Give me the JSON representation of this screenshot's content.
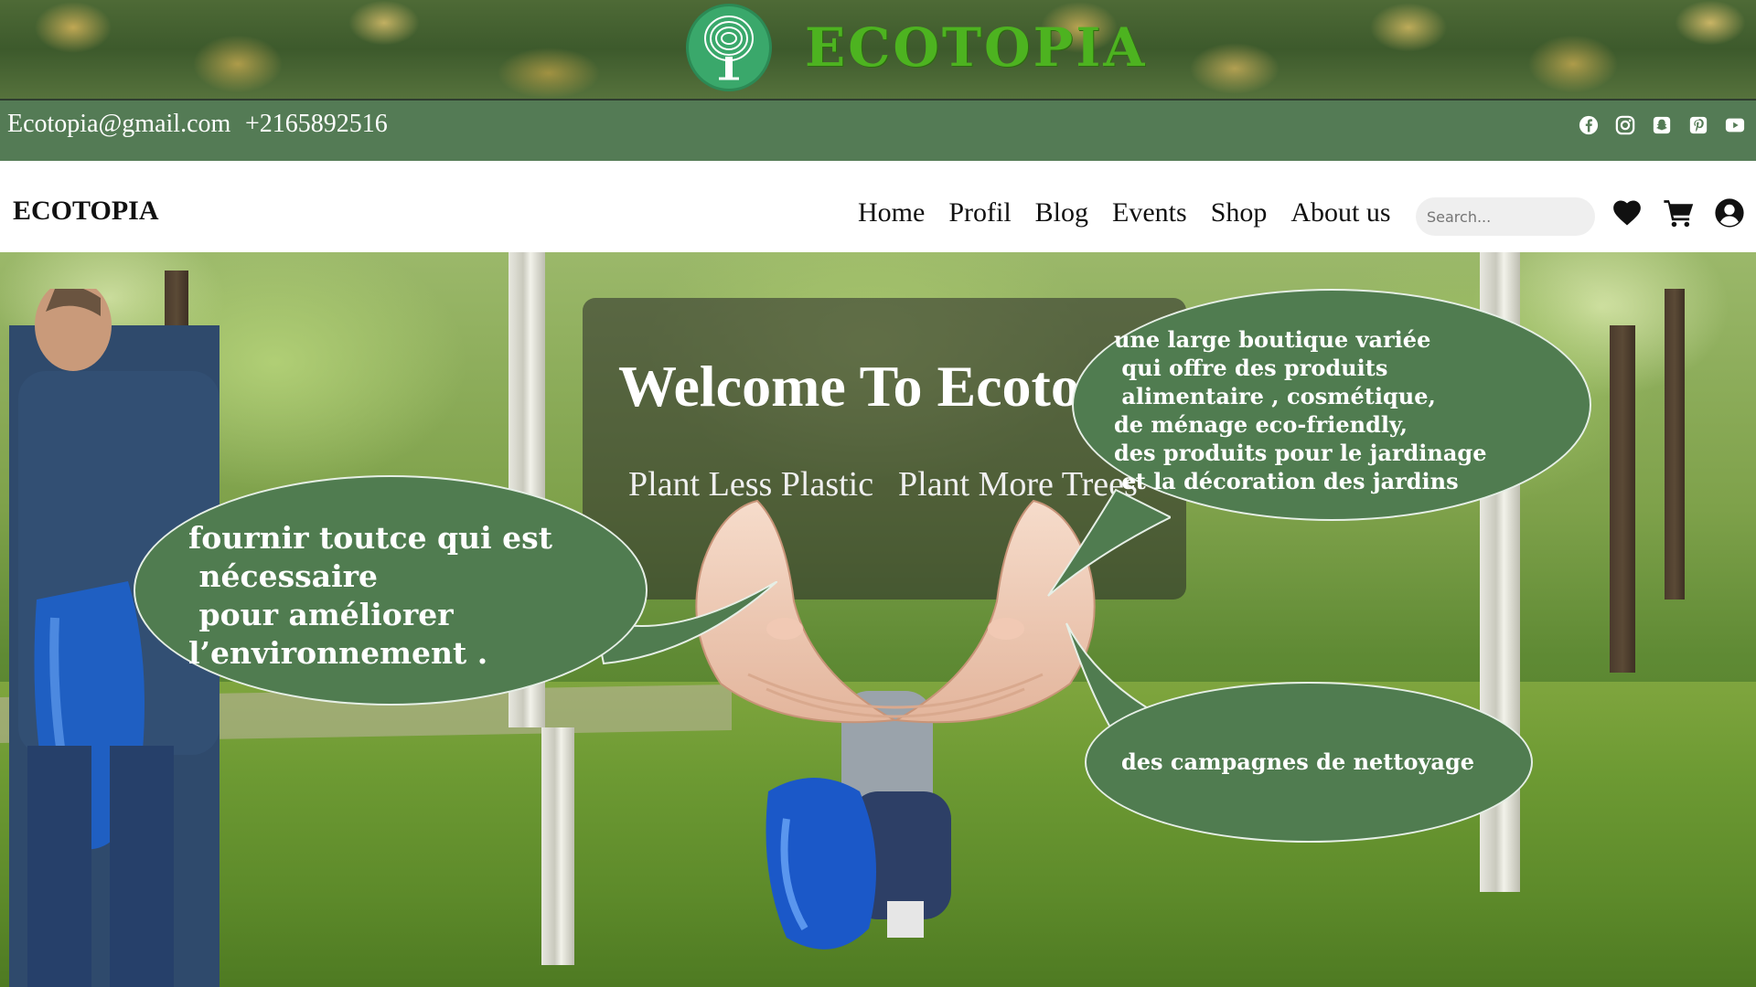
{
  "banner": {
    "title": "ECOTOPIA",
    "logo_icon": "tree-fingerprint-icon"
  },
  "contact": {
    "email": "Ecotopia@gmail.com",
    "phone": "+2165892516",
    "social_icons": [
      "facebook-icon",
      "instagram-icon",
      "snapchat-icon",
      "pinterest-icon",
      "youtube-icon"
    ]
  },
  "navbar": {
    "brand": "ECOTOPIA",
    "links": [
      "Home",
      "Profil",
      "Blog",
      "Events",
      "Shop",
      "About us"
    ],
    "search_placeholder": "Search...",
    "icons": [
      "heart-icon",
      "cart-icon",
      "user-icon"
    ]
  },
  "hero": {
    "welcome_title": "Welcome To Ecotopia",
    "slogan_1": "Plant Less Plastic",
    "slogan_2": "Plant More Trees"
  },
  "bubbles": {
    "left": "fournir toutce qui est\n nécessaire\n pour améliorer\nl’environnement .",
    "right_top": "une large boutique variée\n qui offre des produits\n alimentaire , cosmétique,\nde ménage eco-friendly,\ndes produits pour le jardinage\n et la décoration des jardins",
    "right_bottom": "des campagnes de nettoyage"
  },
  "colors": {
    "contact_bar": "#547b55",
    "bubble": "#507c50",
    "banner_title": "#4db320"
  }
}
